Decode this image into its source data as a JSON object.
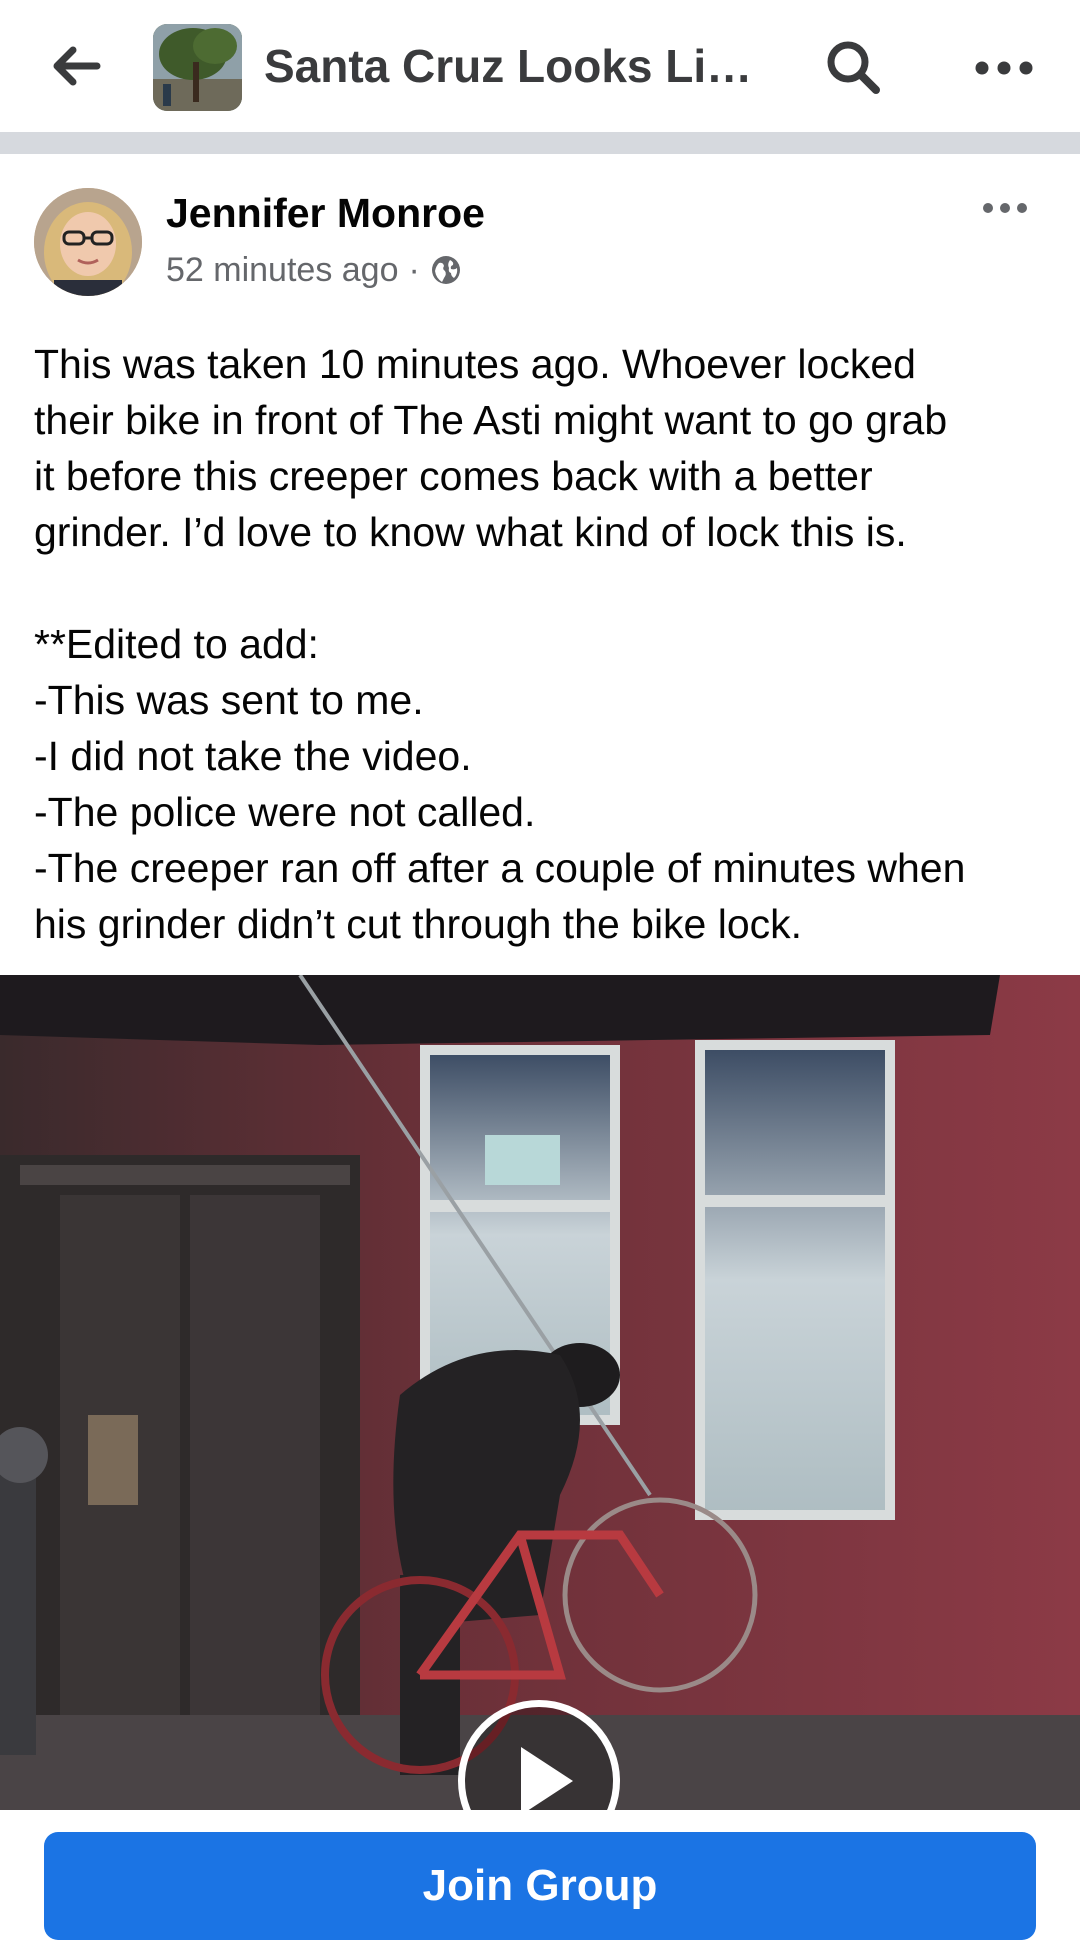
{
  "header": {
    "group_title": "Santa Cruz Looks Like…",
    "back_icon": "arrow-left-icon",
    "search_icon": "search-icon",
    "more_icon": "more-horizontal-icon"
  },
  "post": {
    "author": "Jennifer Monroe",
    "timestamp": "52 minutes ago",
    "separator": "·",
    "privacy_icon": "globe-icon",
    "more_icon": "more-horizontal-icon",
    "lines": [
      "This was taken 10 minutes ago. Whoever locked",
      "their bike in front of The Asti might want to go grab",
      "it before this creeper comes back with a better",
      "grinder. I’d love to know what kind of lock this is.",
      "",
      "**Edited to add:",
      "-This was sent to me.",
      "-I did not take the video.",
      "-The police were not called.",
      "-The creeper ran off after a couple of minutes when",
      "his grinder didn’t cut through the bike lock."
    ]
  },
  "video": {
    "play_icon": "play-icon"
  },
  "footer": {
    "join_label": "Join Group"
  },
  "colors": {
    "brand_blue": "#1b74e4",
    "secondary_text": "#65676b",
    "divider": "#d6d9de"
  }
}
